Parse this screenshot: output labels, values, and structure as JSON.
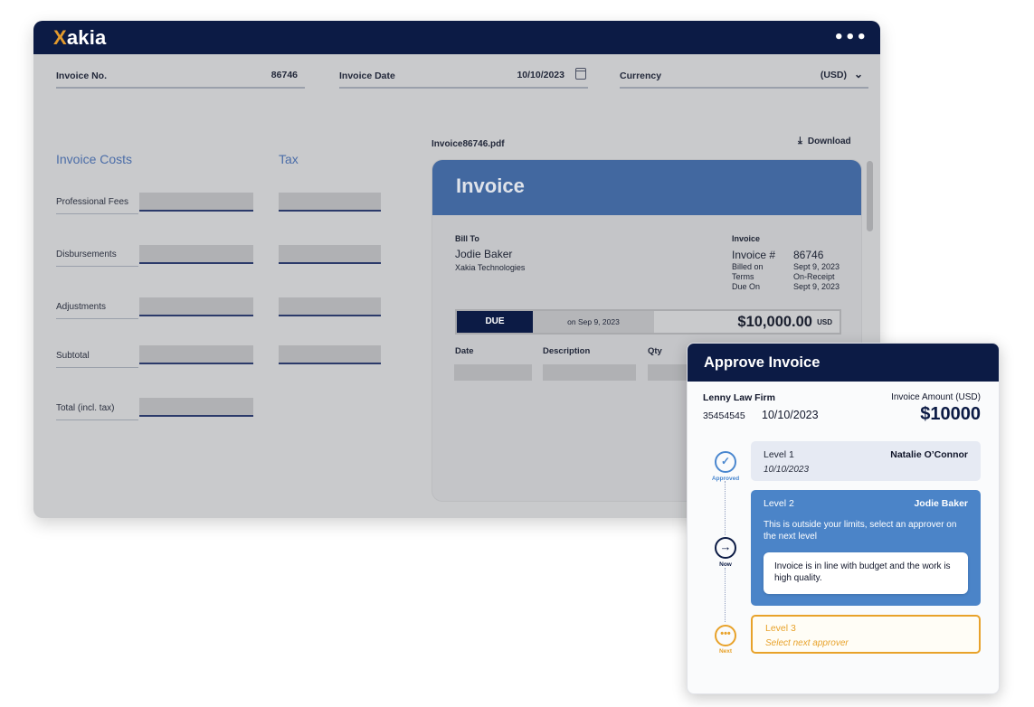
{
  "app": {
    "logo_x": "X",
    "logo_rest": "akia",
    "menu_icon": "more-dots-icon",
    "menu_glyph": "•••"
  },
  "header": {
    "invoice_no_label": "Invoice No.",
    "invoice_no_value": "86746",
    "invoice_date_label": "Invoice Date",
    "invoice_date_value": "10/10/2023",
    "currency_label": "Currency",
    "currency_value": "(USD)"
  },
  "costs": {
    "invoice_costs_title": "Invoice Costs",
    "tax_title": "Tax",
    "rows": [
      "Professional Fees",
      "Disbursements",
      "Adjustments",
      "Subtotal",
      "Total (incl. tax)"
    ]
  },
  "pdf": {
    "file_name": "Invoice86746.pdf",
    "download_label": "Download",
    "title": "Invoice",
    "bill_to_label": "Bill To",
    "bill_to_name": "Jodie Baker",
    "bill_to_company": "Xakia Technologies",
    "invoice_label": "Invoice",
    "invoice_hash_label": "Invoice #",
    "invoice_hash_value": "86746",
    "billed_on_label": "Billed on",
    "billed_on_value": "Sept 9, 2023",
    "terms_label": "Terms",
    "terms_value": "On-Receipt",
    "due_on_label": "Due On",
    "due_on_value": "Sept 9, 2023",
    "due_label": "DUE",
    "due_date": "on Sep 9, 2023",
    "due_amount": "$10,000.00",
    "due_currency": "USD",
    "columns": [
      "Date",
      "Description",
      "Qty"
    ]
  },
  "approve": {
    "title": "Approve Invoice",
    "firm": "Lenny Law Firm",
    "number": "35454545",
    "date": "10/10/2023",
    "amount_label": "Invoice Amount (USD)",
    "amount": "$10000",
    "status_approved": "Approved",
    "status_now": "Now",
    "status_next": "Next",
    "colors": {
      "approved": "#4a87cf",
      "now": "#0c1b45",
      "next": "#e8a22a"
    },
    "level1": {
      "name": "Level 1",
      "approver": "Natalie O’Connor",
      "date": "10/10/2023"
    },
    "level2": {
      "name": "Level 2",
      "approver": "Jodie Baker",
      "message": "This is outside your limits, select an approver on the next level",
      "comment": "Invoice is in line with budget and the work is high quality."
    },
    "level3": {
      "name": "Level 3",
      "placeholder": "Select next approver"
    }
  }
}
